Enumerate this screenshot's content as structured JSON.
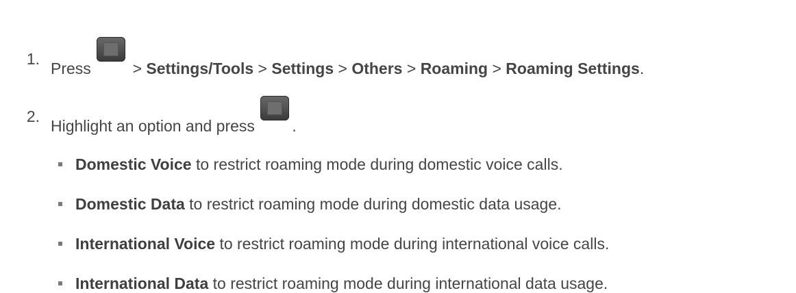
{
  "steps": [
    {
      "number": "1.",
      "prefix": "Press",
      "icon": "phone-menu-key-icon",
      "path": [
        {
          "sep": ">",
          "label": "Settings/Tools"
        },
        {
          "sep": ">",
          "label": "Settings"
        },
        {
          "sep": ">",
          "label": "Others"
        },
        {
          "sep": ">",
          "label": "Roaming"
        },
        {
          "sep": ">",
          "label": "Roaming Settings"
        }
      ],
      "end": "."
    },
    {
      "number": "2.",
      "text": "Highlight an option and press",
      "icon": "phone-ok-key-icon",
      "end": "."
    }
  ],
  "options": [
    {
      "label": "Domestic Voice",
      "description": "to restrict roaming mode during domestic voice calls."
    },
    {
      "label": "Domestic Data",
      "description": "to restrict roaming mode during domestic data usage."
    },
    {
      "label": "International Voice",
      "description": "to restrict roaming mode during international voice calls."
    },
    {
      "label": "International Data",
      "description": "to restrict roaming mode during international data usage."
    }
  ]
}
